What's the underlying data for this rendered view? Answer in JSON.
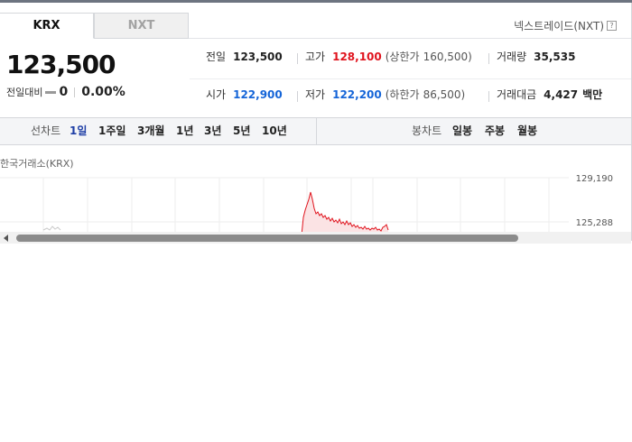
{
  "tabs": {
    "krx": "KRX",
    "nxt": "NXT"
  },
  "nxt_link": "넥스트레이드(NXT)",
  "price": "123,500",
  "change": {
    "label": "전일대비",
    "value": "0",
    "rate": "0.00%"
  },
  "info": {
    "prev_close": {
      "label": "전일",
      "value": "123,500"
    },
    "high": {
      "label": "고가",
      "value": "128,100",
      "limit_label": "(상한가",
      "limit_value": "160,500)"
    },
    "volume": {
      "label": "거래량",
      "value": "35,535"
    },
    "open": {
      "label": "시가",
      "value": "122,900"
    },
    "low": {
      "label": "저가",
      "value": "122,200",
      "limit_label": "(하한가",
      "limit_value": "86,500)"
    },
    "amount": {
      "label": "거래대금",
      "value": "4,427",
      "unit": "백만"
    }
  },
  "period": {
    "line_title": "선차트",
    "line_items": [
      "1일",
      "1주일",
      "3개월",
      "1년",
      "3년",
      "5년",
      "10년"
    ],
    "candle_title": "봉차트",
    "candle_items": [
      "일봉",
      "주봉",
      "월봉"
    ]
  },
  "chart": {
    "exchange_label": "한국거래소(KRX)",
    "y_labels": [
      "129,190",
      "125,288"
    ]
  },
  "colors": {
    "up": "#e0141e",
    "down": "#1565d8",
    "active_period": "#1f3fa6",
    "line": "#e0141e"
  }
}
